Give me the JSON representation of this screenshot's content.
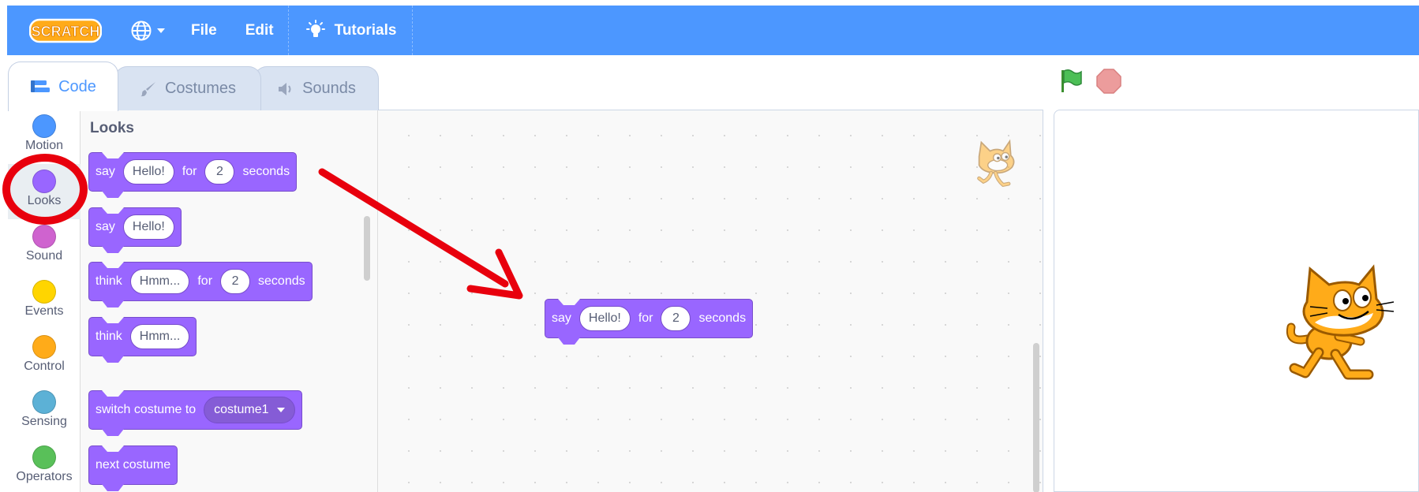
{
  "menubar": {
    "logo_text": "SCRATCH",
    "file_label": "File",
    "edit_label": "Edit",
    "tutorials_label": "Tutorials"
  },
  "tabs": [
    {
      "label": "Code",
      "active": true,
      "icon": "code-blocks-icon"
    },
    {
      "label": "Costumes",
      "active": false,
      "icon": "paintbrush-icon"
    },
    {
      "label": "Sounds",
      "active": false,
      "icon": "speaker-icon"
    }
  ],
  "categories": [
    {
      "label": "Motion",
      "color": "#4C97FF"
    },
    {
      "label": "Looks",
      "color": "#9966FF",
      "selected": true
    },
    {
      "label": "Sound",
      "color": "#CF63CF"
    },
    {
      "label": "Events",
      "color": "#FFD500"
    },
    {
      "label": "Control",
      "color": "#FFAB19"
    },
    {
      "label": "Sensing",
      "color": "#5CB1D6"
    },
    {
      "label": "Operators",
      "color": "#59C059"
    }
  ],
  "palette": {
    "title": "Looks",
    "blocks": {
      "say_for": {
        "word1": "say",
        "text": "Hello!",
        "word2": "for",
        "num": "2",
        "word3": "seconds"
      },
      "say": {
        "word1": "say",
        "text": "Hello!"
      },
      "think_for": {
        "word1": "think",
        "text": "Hmm...",
        "word2": "for",
        "num": "2",
        "word3": "seconds"
      },
      "think": {
        "word1": "think",
        "text": "Hmm..."
      },
      "switch_costume": {
        "word1": "switch costume to",
        "option": "costume1"
      },
      "next_costume": {
        "word1": "next costume"
      }
    }
  },
  "workspace": {
    "block": {
      "word1": "say",
      "text": "Hello!",
      "word2": "for",
      "num": "2",
      "word3": "seconds"
    }
  },
  "colors": {
    "menubar": "#4C97FF",
    "looks_block": "#9966FF",
    "annotation": "#E8000D"
  }
}
